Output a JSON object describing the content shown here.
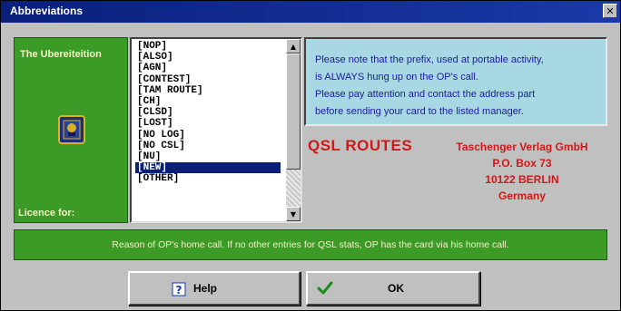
{
  "window": {
    "title": "Abbreviations",
    "close_glyph": "✕"
  },
  "left_panel": {
    "top_label": "The Ubereiteition",
    "bottom_label": "Licence for:",
    "icon": "app-emblem-icon"
  },
  "abbreviations_list": {
    "items": [
      "[NOP]",
      "[ALSO]",
      "[AGN]",
      "[CONTEST]",
      "[TAM ROUTE]",
      "[CH]",
      "[CLSD]",
      "[LOST]",
      "[NO LOG]",
      "[NO CSL]",
      "[NU]",
      "[NEW]",
      "[OTHER]"
    ],
    "selected_index": 11
  },
  "info": {
    "lines": [
      "Please note that the prefix, used at portable activity,",
      "is ALWAYS hung up on the OP's call.",
      "Please pay attention and contact the address part",
      "before sending your card to the listed manager."
    ]
  },
  "qsl": {
    "title": "QSL ROUTES",
    "address": [
      "Taschenger Verlag GmbH",
      "P.O. Box 73",
      "10122 BERLIN",
      "Germany"
    ]
  },
  "footer_note": "Reason of OP's home call. If no other entries for QSL stats, OP has the card via his home call.",
  "buttons": {
    "help": "Help",
    "ok": "OK"
  },
  "colors": {
    "title_bar": "#0a1f7a",
    "panel_green": "#3c9a26",
    "info_bg": "#a8d8e4",
    "qsl_red": "#d01818"
  }
}
